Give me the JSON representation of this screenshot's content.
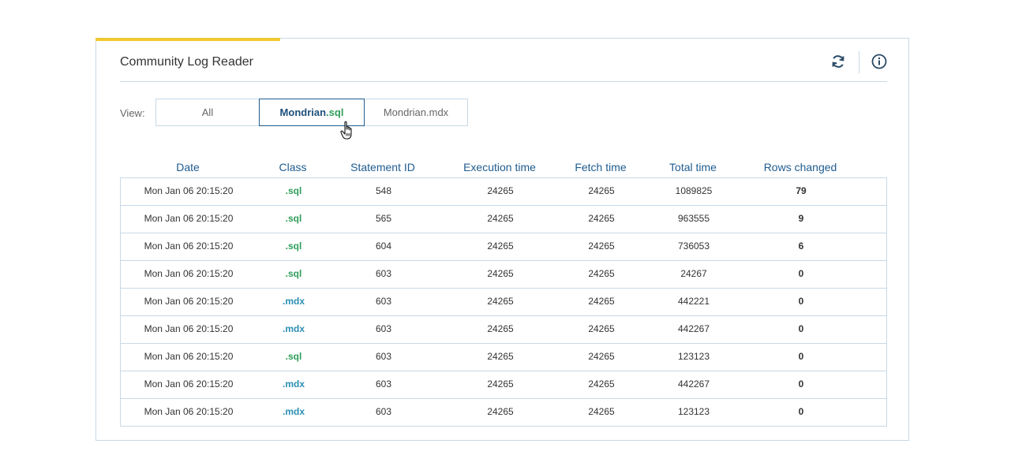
{
  "panel": {
    "title": "Community Log Reader",
    "accent_color": "#f2c830",
    "refresh_icon": "refresh-icon",
    "info_icon": "info-icon"
  },
  "view": {
    "label": "View:",
    "segments": [
      {
        "label": "All",
        "selected": false
      },
      {
        "label_main": "Mondrian",
        "label_suffix": ".sql",
        "selected": true
      },
      {
        "label": "Mondrian.mdx",
        "selected": false
      }
    ]
  },
  "table": {
    "headers": [
      "Date",
      "Class",
      "Statement ID",
      "Execution time",
      "Fetch time",
      "Total time",
      "Rows changed"
    ],
    "rows": [
      {
        "date": "Mon Jan 06  20:15:20",
        "class": ".sql",
        "statement_id": "548",
        "execution_time": "24265",
        "fetch_time": "24265",
        "total_time": "1089825",
        "rows_changed": "79"
      },
      {
        "date": "Mon Jan 06  20:15:20",
        "class": ".sql",
        "statement_id": "565",
        "execution_time": "24265",
        "fetch_time": "24265",
        "total_time": "963555",
        "rows_changed": "9"
      },
      {
        "date": "Mon Jan 06  20:15:20",
        "class": ".sql",
        "statement_id": "604",
        "execution_time": "24265",
        "fetch_time": "24265",
        "total_time": "736053",
        "rows_changed": "6"
      },
      {
        "date": "Mon Jan 06  20:15:20",
        "class": ".sql",
        "statement_id": "603",
        "execution_time": "24265",
        "fetch_time": "24265",
        "total_time": "24267",
        "rows_changed": "0"
      },
      {
        "date": "Mon Jan 06  20:15:20",
        "class": ".mdx",
        "statement_id": "603",
        "execution_time": "24265",
        "fetch_time": "24265",
        "total_time": "442221",
        "rows_changed": "0"
      },
      {
        "date": "Mon Jan 06  20:15:20",
        "class": ".mdx",
        "statement_id": "603",
        "execution_time": "24265",
        "fetch_time": "24265",
        "total_time": "442267",
        "rows_changed": "0"
      },
      {
        "date": "Mon Jan 06  20:15:20",
        "class": ".sql",
        "statement_id": "603",
        "execution_time": "24265",
        "fetch_time": "24265",
        "total_time": "123123",
        "rows_changed": "0"
      },
      {
        "date": "Mon Jan 06  20:15:20",
        "class": ".mdx",
        "statement_id": "603",
        "execution_time": "24265",
        "fetch_time": "24265",
        "total_time": "442267",
        "rows_changed": "0"
      },
      {
        "date": "Mon Jan 06  20:15:20",
        "class": ".mdx",
        "statement_id": "603",
        "execution_time": "24265",
        "fetch_time": "24265",
        "total_time": "123123",
        "rows_changed": "0"
      }
    ]
  }
}
